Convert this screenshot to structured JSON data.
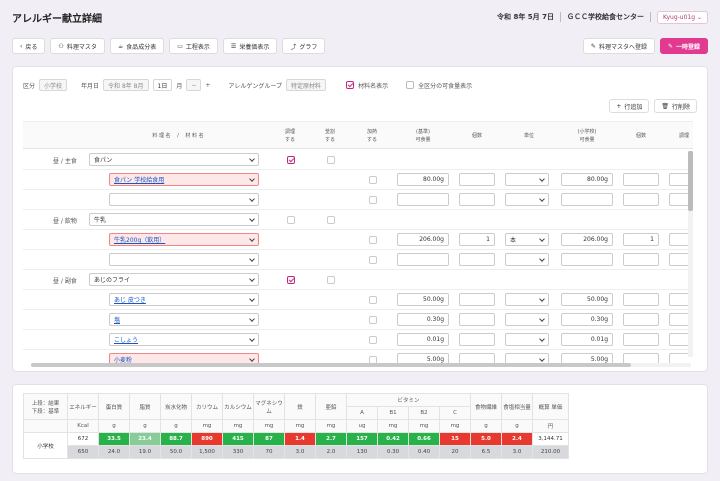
{
  "header": {
    "title": "アレルギー献立詳細",
    "date": "令和 8年 5月 7日",
    "center": "ＧＣＣ学校給食センター",
    "user": "Kyug-u01g"
  },
  "toolbar": {
    "back": "戻る",
    "master": "料理マスタ",
    "component": "食品成分表",
    "process": "工程表示",
    "nutrition": "栄養価表示",
    "graph": "グラフ",
    "register_master": "料理マスタへ登録",
    "temp_save": "一時登録"
  },
  "filters": {
    "kubun_label": "区分",
    "kubun_value": "小学校",
    "date_label": "年月日",
    "date_value": "令和 8年 8月",
    "day_value": "1日",
    "month_unit": "月",
    "minus": "−",
    "plus": "+",
    "allergen_label": "アレルゲングループ",
    "allergen_value": "特定原材料",
    "show_material": "材料名表示",
    "show_all": "全区分の可食量表示"
  },
  "actions": {
    "add_row": "行追加",
    "delete_row": "行削除"
  },
  "columns": {
    "dish": "料 理 名 　/　 材 料 名",
    "prep1": "調理",
    "prep2": "する",
    "mix1": "釜割",
    "mix2": "する",
    "heat1": "加熱",
    "heat2": "する",
    "amt1": "(基準)",
    "amt2": "可食量",
    "count": "個数",
    "unit": "単位",
    "amt_s1": "(小学校)",
    "amt_s2": "可食量",
    "count2": "個数",
    "adjust": "調理"
  },
  "rows": [
    {
      "kind": "dish",
      "label": "昼 / 主食",
      "name": "食パン"
    },
    {
      "kind": "mat",
      "name": "食パン 学校給食用",
      "amount": "80.00g",
      "amount_s": "80.00g",
      "pink": true
    },
    {
      "kind": "empty"
    },
    {
      "kind": "dish",
      "label": "昼 / 飲物",
      "name": "牛乳"
    },
    {
      "kind": "mat",
      "name": "牛乳200g（飲用）",
      "amount": "206.00g",
      "count": "1",
      "unit": "本",
      "amount_s": "206.00g",
      "count2": "1",
      "pink": true
    },
    {
      "kind": "empty"
    },
    {
      "kind": "dish",
      "label": "昼 / 副食",
      "name": "あじのフライ"
    },
    {
      "kind": "mat",
      "name": "あじ 皮つき",
      "amount": "50.00g",
      "amount_s": "50.00g"
    },
    {
      "kind": "mat",
      "name": "塩",
      "amount": "0.30g",
      "amount_s": "0.30g"
    },
    {
      "kind": "mat",
      "name": "こしょう",
      "amount": "0.01g",
      "amount_s": "0.01g"
    },
    {
      "kind": "mat",
      "name": "小麦粉",
      "amount": "5.00g",
      "amount_s": "5.00g",
      "pink": true
    }
  ],
  "nutrition": {
    "head_left1": "上段：結果",
    "head_left2": "下段：基準",
    "vitamin": "ビタミン",
    "names": [
      "エネルギー",
      "蛋白質",
      "脂質",
      "炭水化物",
      "カリウム",
      "カルシウム",
      "マグネシウム",
      "鉄",
      "亜鉛",
      "A",
      "B1",
      "B2",
      "C",
      "食物繊維",
      "食塩相当量",
      "概算 単価"
    ],
    "units": [
      "Kcal",
      "g",
      "g",
      "g",
      "mg",
      "mg",
      "mg",
      "mg",
      "mg",
      "ug",
      "mg",
      "mg",
      "mg",
      "g",
      "g",
      "円"
    ],
    "school": "小学校",
    "result": [
      "672",
      "33.5",
      "23.4",
      "88.7",
      "890",
      "415",
      "87",
      "1.4",
      "2.7",
      "157",
      "0.42",
      "0.66",
      "15",
      "5.0",
      "2.4",
      "3,144.71"
    ],
    "standard": [
      "650",
      "24.0",
      "19.0",
      "50.0",
      "1,500",
      "330",
      "70",
      "3.0",
      "2.0",
      "130",
      "0.30",
      "0.40",
      "20",
      "6.5",
      "3.0",
      "210.00"
    ],
    "result_colors": [
      "#ffffff",
      "#27b34a",
      "#88cc99",
      "#27b34a",
      "#e8392e",
      "#27b34a",
      "#27b34a",
      "#e8392e",
      "#27b34a",
      "#27b34a",
      "#27b34a",
      "#27b34a",
      "#e8392e",
      "#e8392e",
      "#e8392e",
      "#ffffff"
    ]
  }
}
